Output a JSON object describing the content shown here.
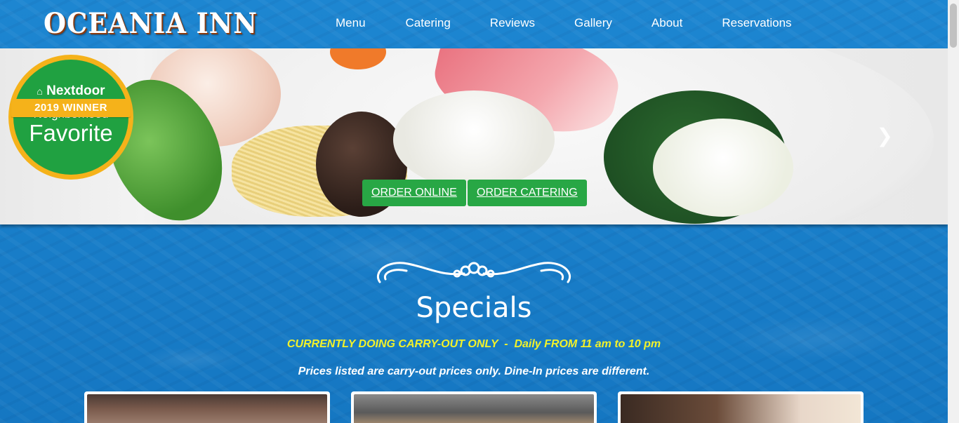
{
  "brand": {
    "name": "OCEANIA INN"
  },
  "nav": {
    "items": [
      "Menu",
      "Catering",
      "Reviews",
      "Gallery",
      "About",
      "Reservations"
    ]
  },
  "badge": {
    "brand": "Nextdoor",
    "line1": "Neighborhood",
    "line2": "Favorite",
    "ribbon": "2019 WINNER"
  },
  "hero": {
    "order_online": "ORDER ONLINE",
    "order_catering": "ORDER CATERING",
    "next_icon": "chevron-right-icon"
  },
  "specials": {
    "title": "Specials",
    "notice": "CURRENTLY DOING CARRY-OUT ONLY  -  Daily FROM 11 am to 10 pm",
    "prices_note": "Prices listed are carry-out prices only. Dine-In prices are different."
  },
  "colors": {
    "background": "#1a7fc9",
    "button": "#28a745",
    "notice": "#f2f22a",
    "badge_green": "#20a141",
    "badge_gold": "#f5b21a"
  }
}
